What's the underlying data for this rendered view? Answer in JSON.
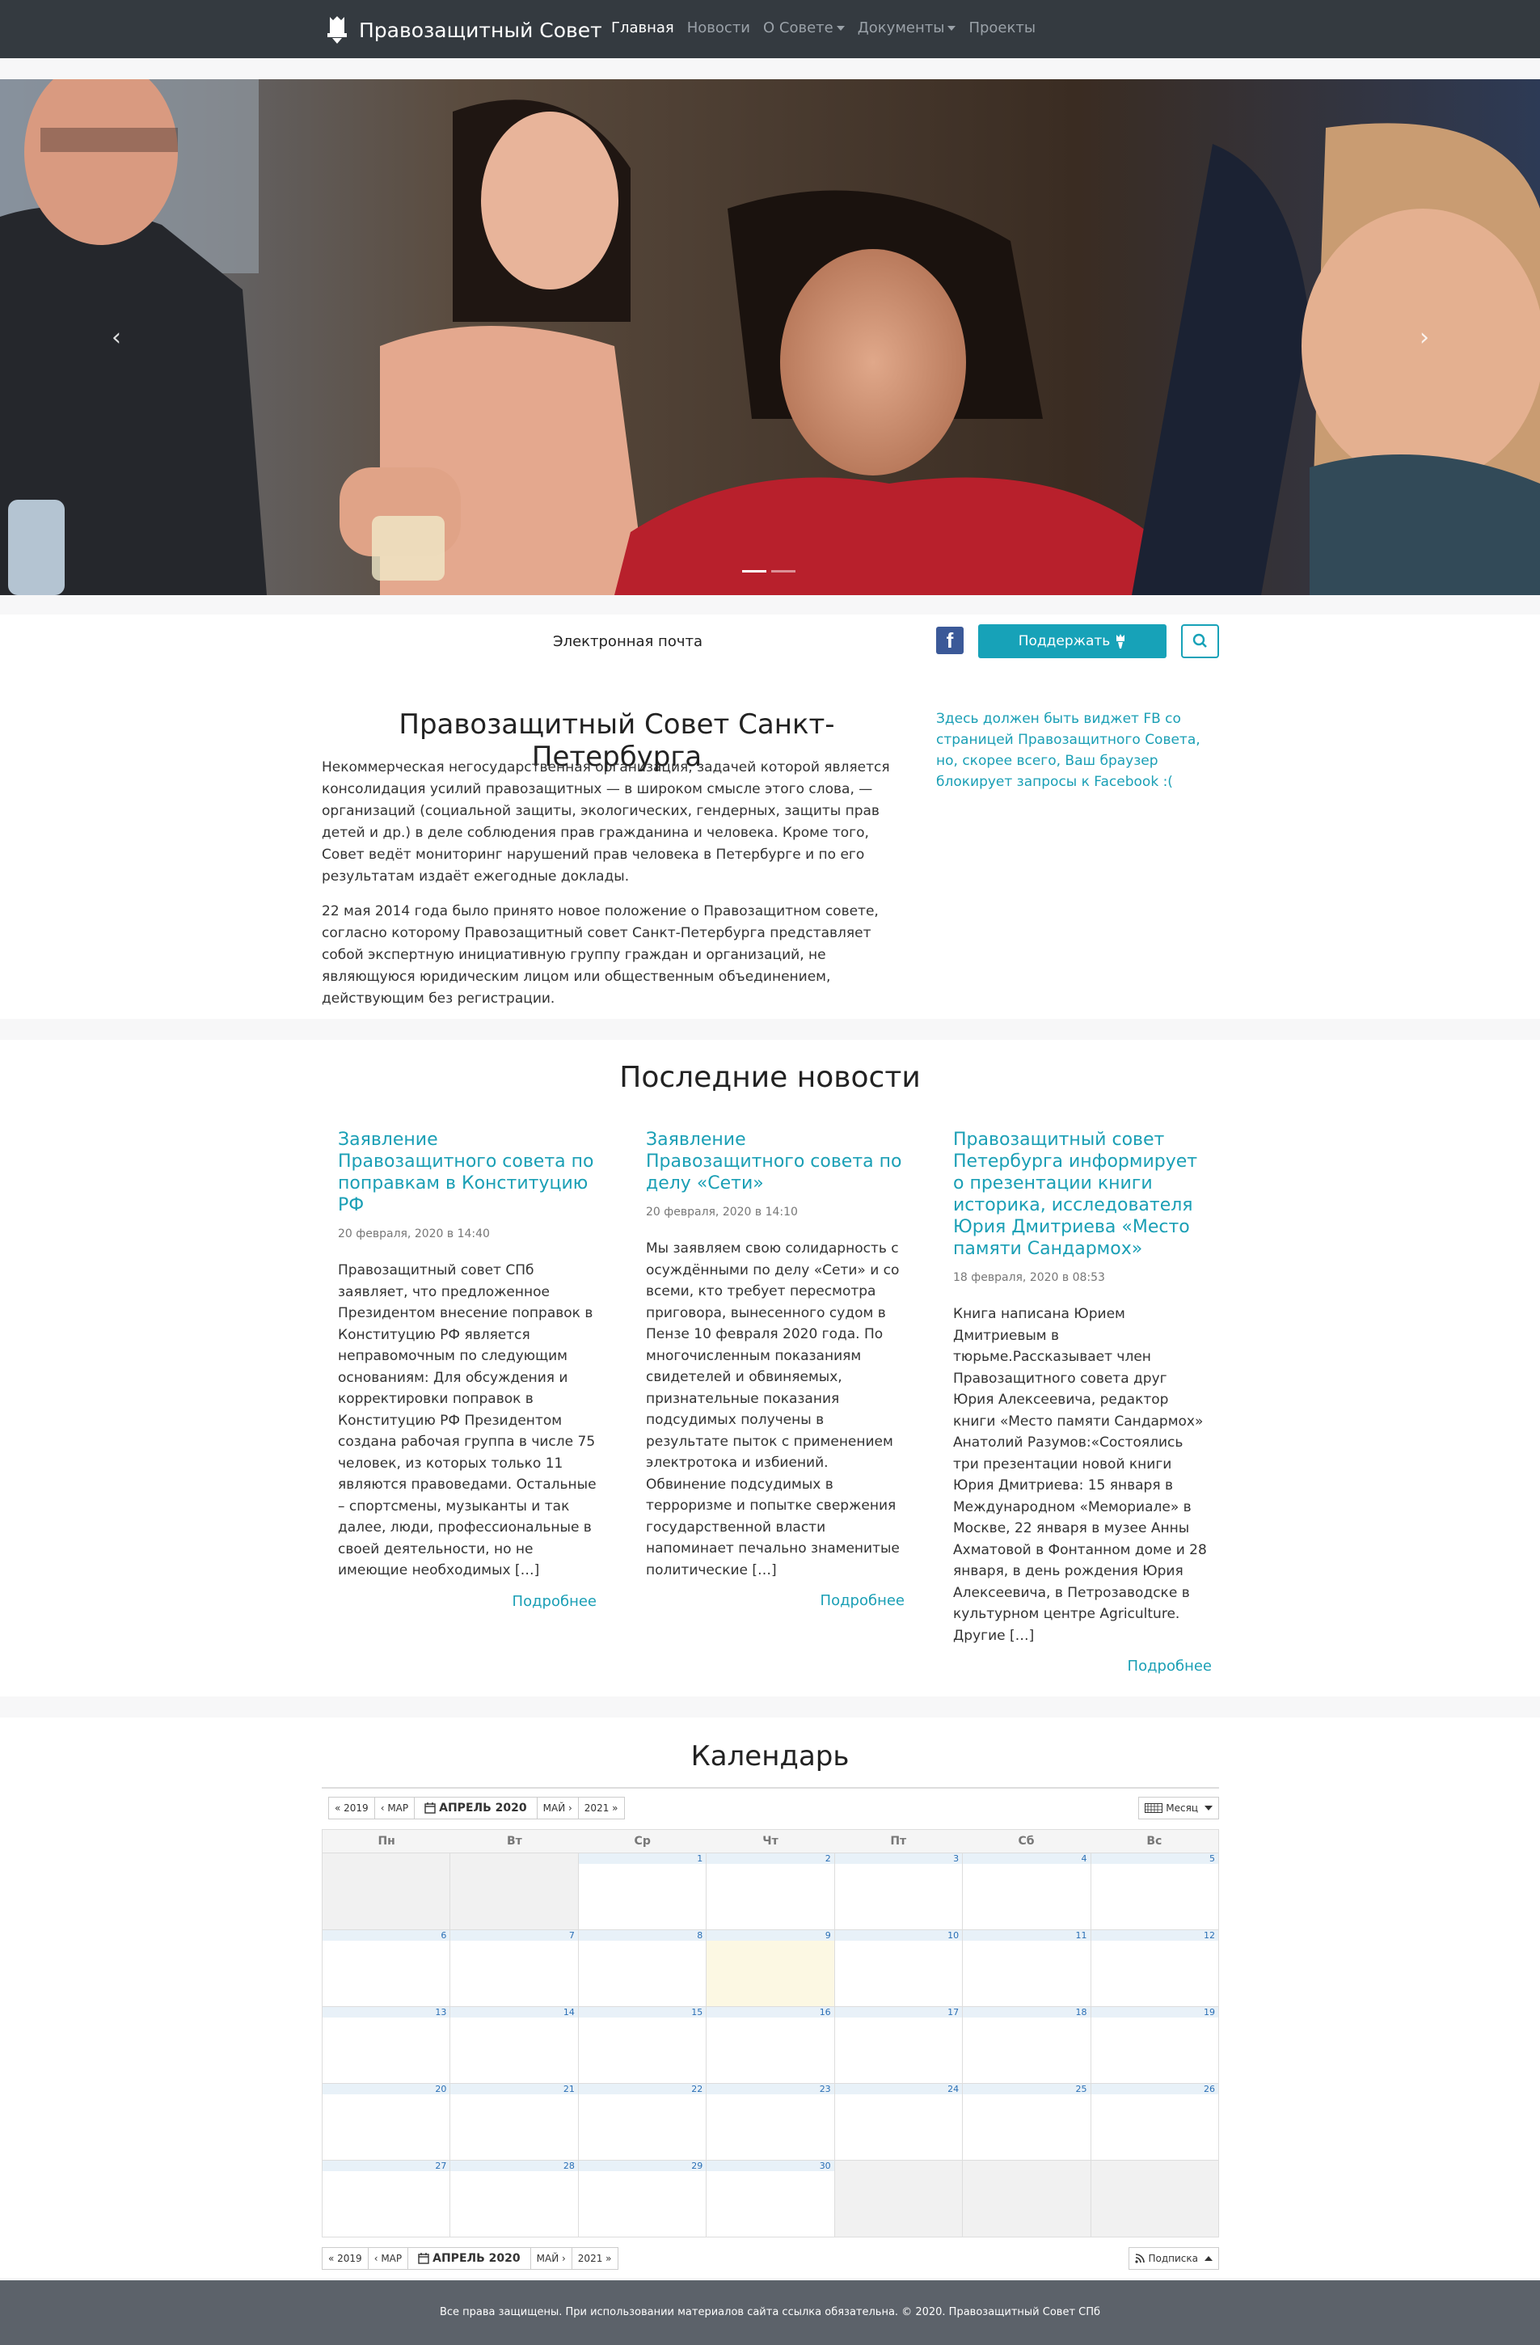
{
  "navbar": {
    "brand": "Правозащитный Совет",
    "items": [
      {
        "label": "Главная",
        "active": true,
        "dropdown": false
      },
      {
        "label": "Новости",
        "active": false,
        "dropdown": false
      },
      {
        "label": "О Совете",
        "active": false,
        "dropdown": true
      },
      {
        "label": "Документы",
        "active": false,
        "dropdown": true
      },
      {
        "label": "Проекты",
        "active": false,
        "dropdown": false
      }
    ]
  },
  "carousel": {
    "prev_icon": "chevron-left-icon",
    "next_icon": "chevron-right-icon",
    "active_slide": 1,
    "slide_count": 2
  },
  "support": {
    "email_label": "Электронная почта",
    "facebook_icon": "facebook-icon",
    "donate_label": "Поддержать",
    "donate_icon": "torch-icon",
    "search_icon": "search-icon"
  },
  "about": {
    "title": "Правозащитный Совет Санкт-Петербурга",
    "paragraph_1": "Некоммерческая негосударственная организация, задачей которой является консолидация усилий правозащитных — в широком смысле этого слова, — организаций (социальной защиты, экологических, гендерных, защиты прав детей и др.) в деле соблюдения прав гражданина и человека. Кроме того, Совет ведёт мониторинг нарушений прав человека в Петербурге и по его результатам издаёт ежегодные доклады.",
    "paragraph_2": "22 мая 2014 года было принято новое положение о Правозащитном совете, согласно которому Правозащитный совет Санкт-Петербурга представляет собой экспертную инициативную группу граждан и организаций, не являющуюся юридическим лицом или общественным объединением, действующим без регистрации.",
    "fb_widget_note": "Здесь должен быть виджет FB со страницей Правозащитного Совета, но, скорее всего, Ваш браузер блокирует запросы к Facebook :("
  },
  "news": {
    "title": "Последние новости",
    "items": [
      {
        "title": "Заявление Правозащитного совета по поправкам в Конституцию РФ",
        "date": "20 февраля, 2020 в 14:40",
        "excerpt": "Правозащитный совет СПб заявляет, что предложенное Президентом внесение поправок в Конституцию РФ является неправомочным по следующим основаниям: Для обсуждения и корректировки поправок в Конституцию РФ Президентом создана рабочая группа в числе 75 человек, из которых только 11 являются правоведами. Остальные – спортсмены, музыканты и так далее, люди, профессиональные в своей деятельности, но не имеющие необходимых […]",
        "more": "Подробнее"
      },
      {
        "title": "Заявление Правозащитного совета по делу «Сети»",
        "date": "20 февраля, 2020 в 14:10",
        "excerpt": "Мы заявляем свою солидарность с осуждёнными по делу «Сети» и со всеми, кто требует пересмотра приговора, вынесенного судом в Пензе 10 февраля 2020 года. По многочисленным показаниям свидетелей и обвиняемых, признательные показания подсудимых получены в результате пыток с применением электротока и избиений. Обвинение подсудимых в терроризме и попытке свержения государственной власти напоминает печально знаменитые политические […]",
        "more": "Подробнее"
      },
      {
        "title": "Правозащитный совет Петербурга информирует о презентации книги историка, исследователя Юрия Дмитриева «Место памяти Сандармох»",
        "date": "18 февраля, 2020 в 08:53",
        "excerpt": "Книга написана Юрием Дмитриевым в тюрьме.Рассказывает член Правозащитного совета друг Юрия Алексеевича, редактор книги «Место памяти Сандармох» Анатолий Разумов:«Состоялись три презентации новой книги Юрия Дмитриева: 15 января в Международном «Мемориале» в Москве, 22 января в музее Анны Ахматовой в Фонтанном доме и 28 января, в день рождения Юрия Алексеевича, в Петрозаводске в культурном центре Agriculture. Другие […]",
        "more": "Подробнее"
      }
    ]
  },
  "calendar": {
    "title": "Календарь",
    "nav": {
      "prev_year": "« 2019",
      "prev_month": "‹ МАР",
      "current": "АПРЕЛЬ 2020",
      "next_month": "МАЙ ›",
      "next_year": "2021 »"
    },
    "view_label": "Месяц",
    "subscribe_label": "Подписка",
    "weekdays": [
      "Пн",
      "Вт",
      "Ср",
      "Чт",
      "Пт",
      "Сб",
      "Вс"
    ],
    "weeks": [
      [
        "",
        "",
        "1",
        "2",
        "3",
        "4",
        "5"
      ],
      [
        "6",
        "7",
        "8",
        "9",
        "10",
        "11",
        "12"
      ],
      [
        "13",
        "14",
        "15",
        "16",
        "17",
        "18",
        "19"
      ],
      [
        "20",
        "21",
        "22",
        "23",
        "24",
        "25",
        "26"
      ],
      [
        "27",
        "28",
        "29",
        "30",
        "",
        "",
        ""
      ]
    ],
    "today": "9"
  },
  "footer": {
    "text": "Все права защищены. При использовании материалов сайта ссылка обязательна. © 2020. Правозащитный Совет СПб"
  }
}
